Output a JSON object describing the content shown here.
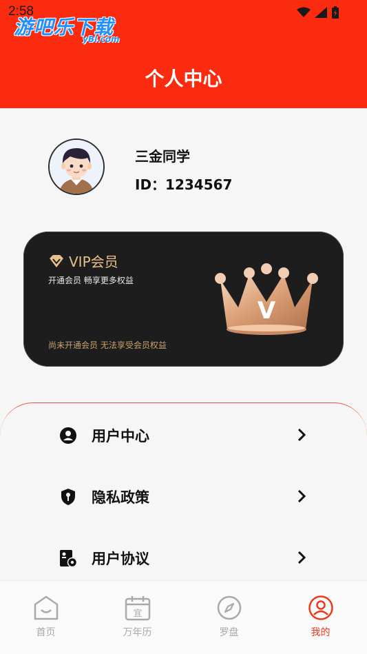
{
  "status_bar": {
    "time": "2:58"
  },
  "watermark": {
    "main": "游吧乐下载",
    "sub": "yBl.com"
  },
  "header": {
    "title": "个人中心"
  },
  "profile": {
    "name": "三金同学",
    "id_text": "ID：1234567"
  },
  "vip_card": {
    "title": "VIP会员",
    "subtitle": "开通会员 畅享更多权益",
    "status": "尚未开通会员 无法享受会员权益",
    "crown_letter": "V"
  },
  "menu": {
    "items": [
      {
        "label": "用户中心",
        "icon": "user-circle-icon"
      },
      {
        "label": "隐私政策",
        "icon": "shield-key-icon"
      },
      {
        "label": "用户协议",
        "icon": "agreement-icon"
      }
    ]
  },
  "tabbar": {
    "tabs": [
      {
        "label": "首页",
        "icon": "home-icon",
        "active": false
      },
      {
        "label": "万年历",
        "icon": "calendar-icon",
        "active": false
      },
      {
        "label": "罗盘",
        "icon": "compass-icon",
        "active": false
      },
      {
        "label": "我的",
        "icon": "profile-icon",
        "active": true
      }
    ],
    "calendar_glyph": "宜"
  },
  "colors": {
    "accent": "#fb2b10",
    "vip_gold": "#e8c08a",
    "card_bg": "#1d1d1d",
    "tab_active": "#f2361a"
  }
}
